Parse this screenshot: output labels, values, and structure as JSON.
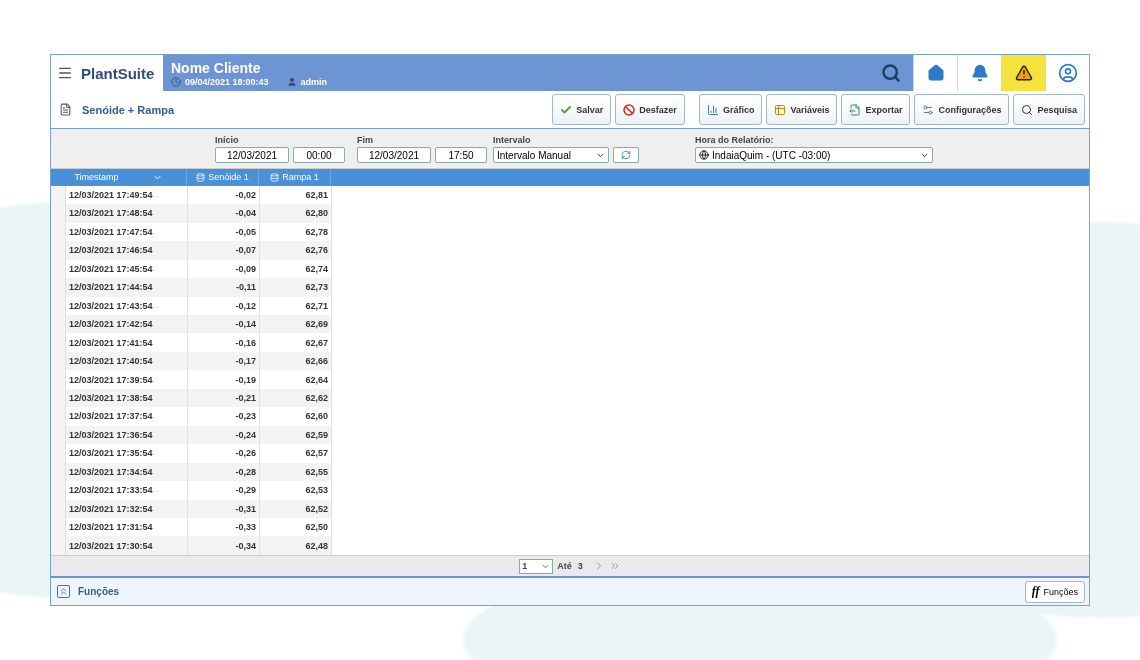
{
  "header": {
    "brand": "PlantSuite",
    "client": "Nome Cliente",
    "datetime": "09/04/2021 18:00:43",
    "user": "admin",
    "actions": [
      {
        "kind": "home",
        "selected": false
      },
      {
        "kind": "alarm",
        "selected": false
      },
      {
        "kind": "warning",
        "selected": true
      },
      {
        "kind": "profile",
        "selected": false
      }
    ]
  },
  "toolbar": {
    "title": "Senóide + Rampa",
    "buttons": [
      {
        "kind": "save",
        "label": "Salvar"
      },
      {
        "kind": "undo",
        "label": "Desfazer"
      },
      {
        "kind": "chart",
        "label": "Gráfico"
      },
      {
        "kind": "variables",
        "label": "Variáveis"
      },
      {
        "kind": "export",
        "label": "Exportar"
      },
      {
        "kind": "settings",
        "label": "Configurações"
      },
      {
        "kind": "search",
        "label": "Pesquisa"
      }
    ]
  },
  "filters": {
    "start_label": "Início",
    "start_date": "12/03/2021",
    "start_time": "00:00",
    "end_label": "Fim",
    "end_date": "12/03/2021",
    "end_time": "17:50",
    "interval_label": "Intervalo",
    "interval": "Intervalo Manual",
    "timezone_label": "Hora do Relatório:",
    "timezone": "IndaiaQuim - (UTC -03:00)"
  },
  "table": {
    "columns": [
      "Timestamp",
      "Senóide 1",
      "Rampa 1"
    ],
    "rows": [
      [
        "12/03/2021 17:49:54",
        "-0,02",
        "62,81"
      ],
      [
        "12/03/2021 17:48:54",
        "-0,04",
        "62,80"
      ],
      [
        "12/03/2021 17:47:54",
        "-0,05",
        "62,78"
      ],
      [
        "12/03/2021 17:46:54",
        "-0,07",
        "62,76"
      ],
      [
        "12/03/2021 17:45:54",
        "-0,09",
        "62,74"
      ],
      [
        "12/03/2021 17:44:54",
        "-0,11",
        "62,73"
      ],
      [
        "12/03/2021 17:43:54",
        "-0,12",
        "62,71"
      ],
      [
        "12/03/2021 17:42:54",
        "-0,14",
        "62,69"
      ],
      [
        "12/03/2021 17:41:54",
        "-0,16",
        "62,67"
      ],
      [
        "12/03/2021 17:40:54",
        "-0,17",
        "62,66"
      ],
      [
        "12/03/2021 17:39:54",
        "-0,19",
        "62,64"
      ],
      [
        "12/03/2021 17:38:54",
        "-0,21",
        "62,62"
      ],
      [
        "12/03/2021 17:37:54",
        "-0,23",
        "62,60"
      ],
      [
        "12/03/2021 17:36:54",
        "-0,24",
        "62,59"
      ],
      [
        "12/03/2021 17:35:54",
        "-0,26",
        "62,57"
      ],
      [
        "12/03/2021 17:34:54",
        "-0,28",
        "62,55"
      ],
      [
        "12/03/2021 17:33:54",
        "-0,29",
        "62,53"
      ],
      [
        "12/03/2021 17:32:54",
        "-0,31",
        "62,52"
      ],
      [
        "12/03/2021 17:31:54",
        "-0,33",
        "62,50"
      ],
      [
        "12/03/2021 17:30:54",
        "-0,34",
        "62,48"
      ]
    ]
  },
  "pager": {
    "page": "1",
    "until_label": "Até",
    "total": "3"
  },
  "footer": {
    "title": "Funções",
    "button_glyph": "ff",
    "button_label": "Funções"
  }
}
